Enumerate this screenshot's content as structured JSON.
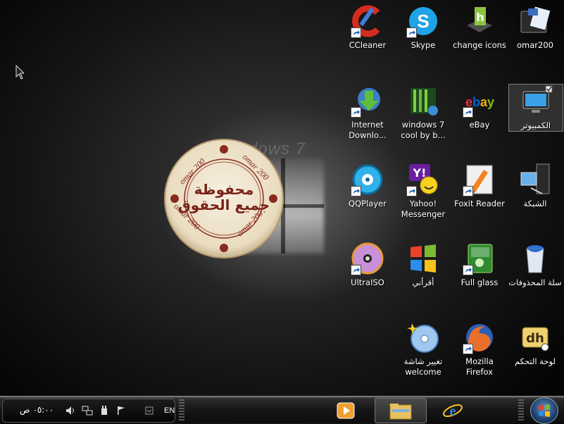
{
  "desktop": {
    "watermark": "dows 7",
    "seal": {
      "arc_text": "omar 200",
      "center_line1": "محفوظة",
      "center_line2": "جميع الحقوق"
    },
    "icons": [
      {
        "label": "CCleaner",
        "icon": "ccleaner-icon",
        "shortcut": true
      },
      {
        "label": "Skype",
        "icon": "skype-icon",
        "shortcut": true
      },
      {
        "label": "change icons",
        "icon": "change-icons-icon",
        "shortcut": false
      },
      {
        "label": "omar200",
        "icon": "folder-icon",
        "shortcut": false
      },
      {
        "label": "Internet Downlo...",
        "icon": "internet-download-manager-icon",
        "shortcut": true
      },
      {
        "label": "windows 7 cool by b...",
        "icon": "video-file-icon",
        "shortcut": false
      },
      {
        "label": "eBay",
        "icon": "ebay-icon",
        "shortcut": true
      },
      {
        "label": "الكمبيوتر",
        "icon": "computer-icon",
        "shortcut": false
      },
      {
        "label": "QQPlayer",
        "icon": "qqplayer-icon",
        "shortcut": true
      },
      {
        "label": "Yahoo! Messenger",
        "icon": "yahoo-messenger-icon",
        "shortcut": true
      },
      {
        "label": "Foxit Reader",
        "icon": "foxit-reader-icon",
        "shortcut": true
      },
      {
        "label": "الشبكة",
        "icon": "network-icon",
        "shortcut": false
      },
      {
        "label": "UltraISO",
        "icon": "ultraiso-icon",
        "shortcut": true
      },
      {
        "label": "أقرأني",
        "icon": "readme-windows-icon",
        "shortcut": false
      },
      {
        "label": "Full glass",
        "icon": "full-glass-icon",
        "shortcut": true
      },
      {
        "label": "سلة المحذوفات",
        "icon": "recycle-bin-icon",
        "shortcut": false
      },
      {
        "label": "تغيير شاشة welcome",
        "icon": "welcome-screen-icon",
        "shortcut": false
      },
      {
        "label": "Mozilla Firefox",
        "icon": "firefox-icon",
        "shortcut": true
      },
      {
        "label": "لوحة التحكم",
        "icon": "control-panel-icon",
        "shortcut": false
      }
    ]
  },
  "taskbar": {
    "clock": "٠٥:٠٠ ص",
    "language": "EN",
    "tray_icons": [
      "volume-icon",
      "network-tray-icon",
      "power-plug-icon",
      "action-center-flag-icon"
    ],
    "buttons": [
      {
        "name": "media-player-taskbar-button",
        "icon": "media-player-icon",
        "active": false
      },
      {
        "name": "explorer-taskbar-button",
        "icon": "folder-icon",
        "active": true
      },
      {
        "name": "internet-explorer-taskbar-button",
        "icon": "internet-explorer-icon",
        "active": false
      }
    ],
    "start": "start-orb-icon"
  },
  "colors": {
    "taskbar": "#161616",
    "selection": "#5a5a5a",
    "accent": "#1d3d6a"
  }
}
